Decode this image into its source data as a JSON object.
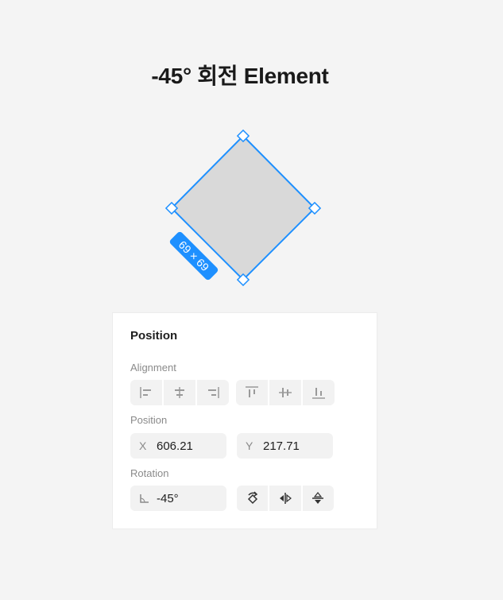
{
  "heading": "-45° 회전 Element",
  "canvas": {
    "dimension_badge": "69 × 69",
    "selection_color": "#1e90ff",
    "shape_fill": "#d9d9d9"
  },
  "panel": {
    "title": "Position",
    "alignment_label": "Alignment",
    "alignment_buttons": [
      "align-left-icon",
      "align-center-horizontal-icon",
      "align-right-icon",
      "align-top-icon",
      "align-center-vertical-icon",
      "align-bottom-icon"
    ],
    "position_label": "Position",
    "x_label": "X",
    "x_value": "606.21",
    "y_label": "Y",
    "y_value": "217.71",
    "rotation_label": "Rotation",
    "rotation_value": "-45°",
    "rotation_buttons": [
      "rotate-icon",
      "flip-horizontal-icon",
      "flip-vertical-icon"
    ]
  }
}
